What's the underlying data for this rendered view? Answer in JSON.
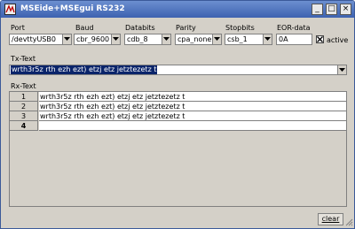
{
  "window": {
    "title": "MSEide+MSEgui RS232",
    "buttons": [
      "_",
      "□",
      "×"
    ]
  },
  "labels": {
    "port": "Port",
    "baud": "Baud",
    "databits": "Databits",
    "parity": "Parity",
    "stopbits": "Stopbits",
    "eor": "EOR-data",
    "tx": "Tx-Text",
    "rx": "Rx-Text"
  },
  "fields": {
    "port": "/devttyUSB0",
    "baud": "cbr_9600",
    "databits": "cdb_8",
    "parity": "cpa_none",
    "stopbits": "csb_1",
    "eor": "0A"
  },
  "active": {
    "label": "active",
    "checked": true
  },
  "tx_text": "wrth3r5z rth ezh ezt) etzj etz jetztezetz t",
  "rx_rows": [
    {
      "num": "1",
      "text": "wrth3r5z rth ezh ezt) etzj etz jetztezetz t"
    },
    {
      "num": "2",
      "text": "wrth3r5z rth ezh ezt) etzj etz jetztezetz t"
    },
    {
      "num": "3",
      "text": "wrth3r5z rth ezh ezt) etzj etz jetztezetz t"
    },
    {
      "num": "4",
      "text": ""
    }
  ],
  "clear_button": "clear",
  "colors": {
    "titlebar": "#3d62b0",
    "selection": "#0a246a"
  }
}
